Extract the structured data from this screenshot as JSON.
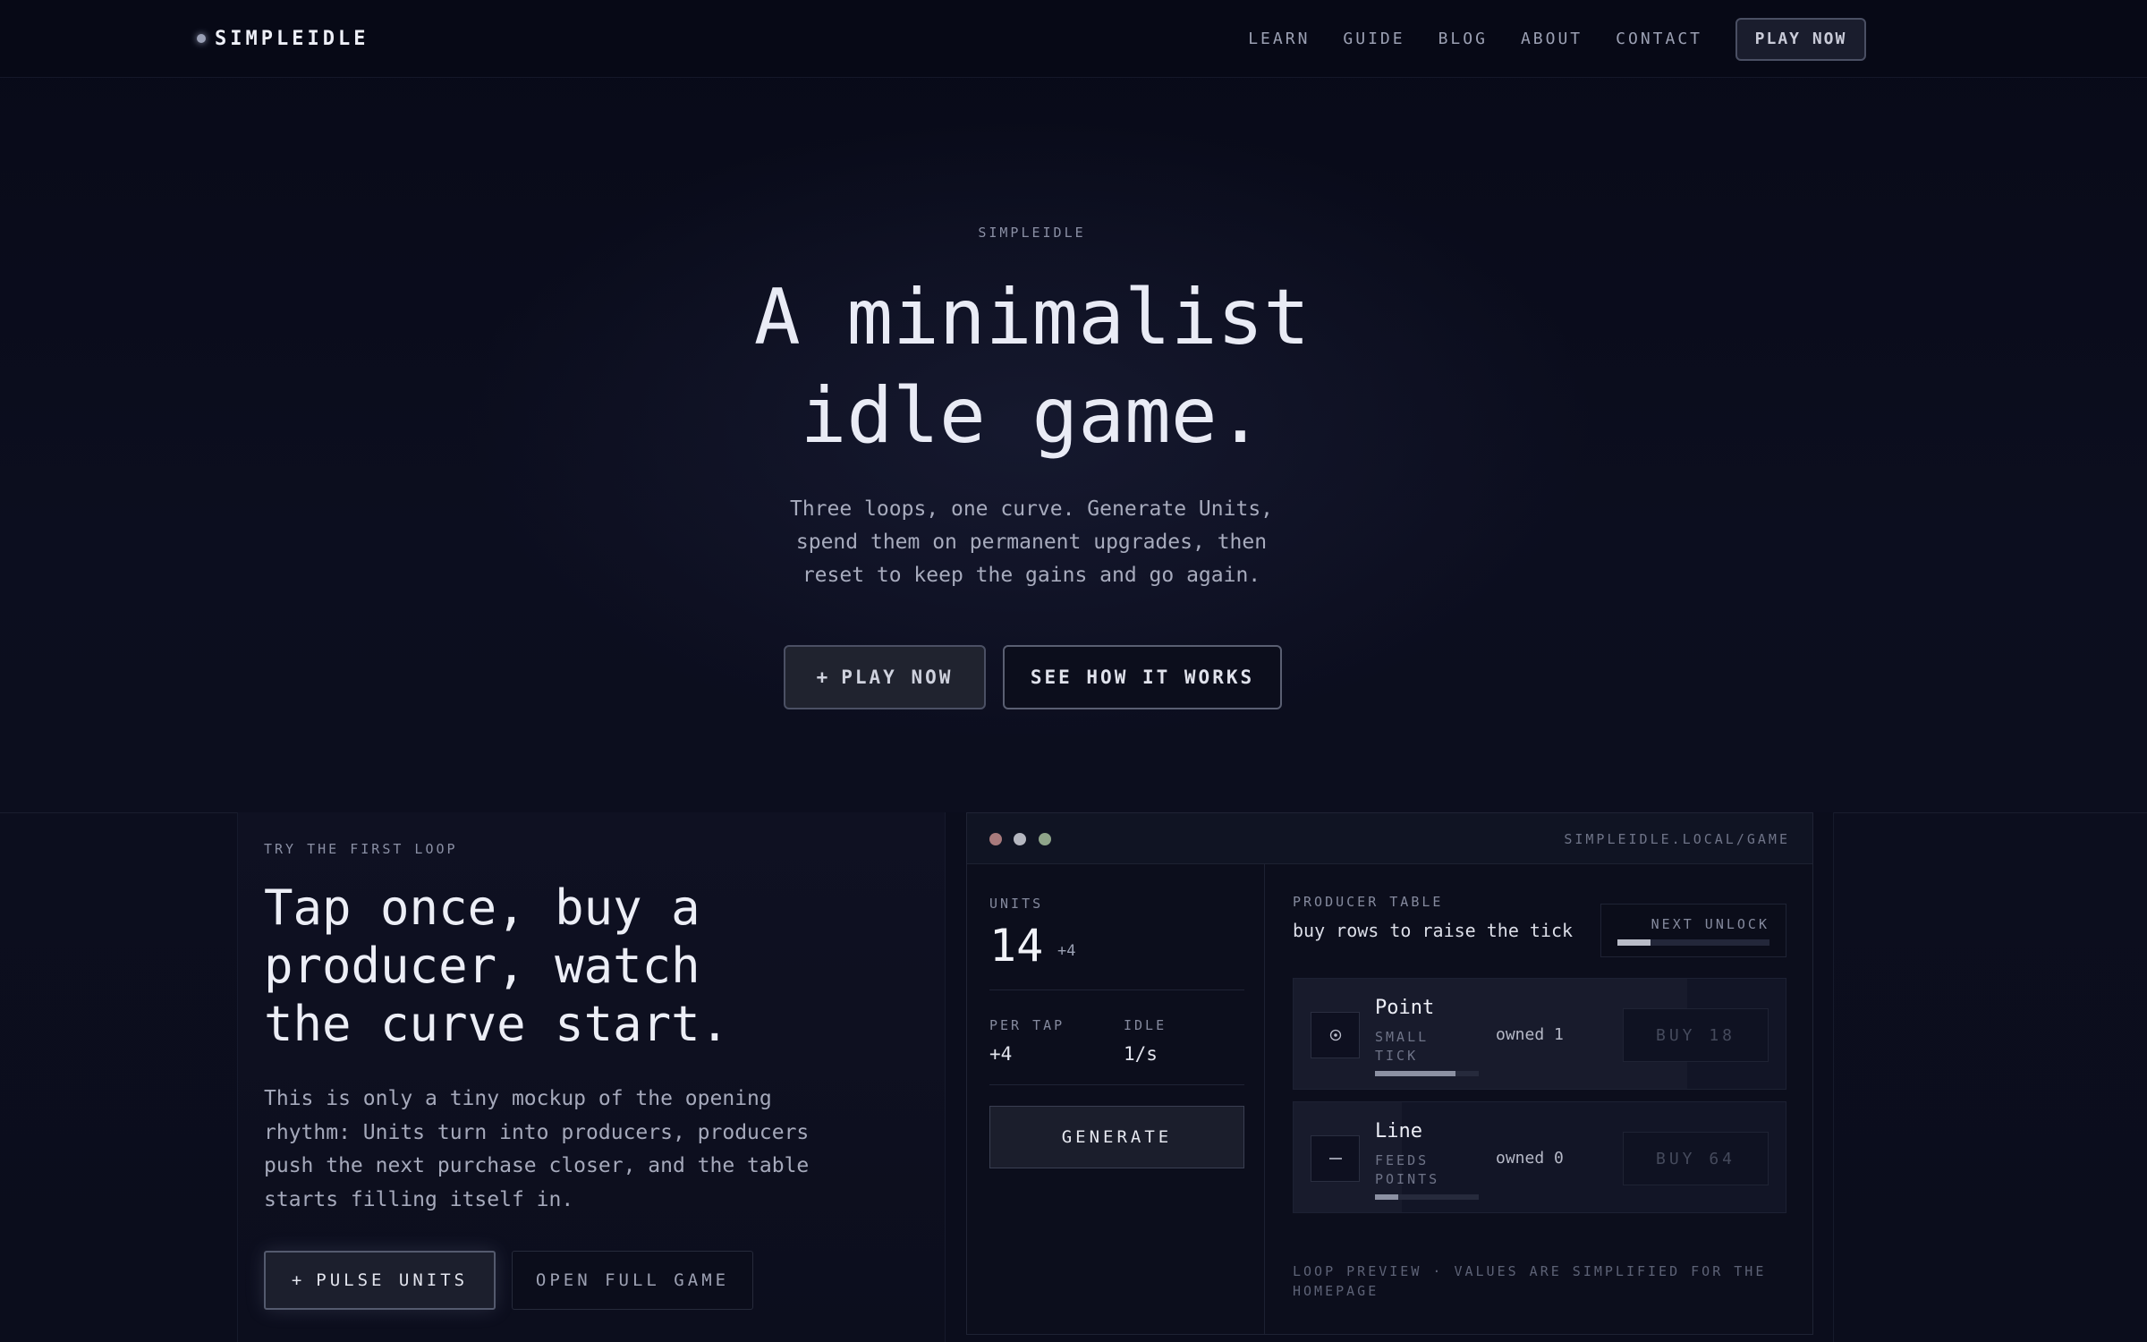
{
  "nav": {
    "brand": "SIMPLEIDLE",
    "links": [
      "LEARN",
      "GUIDE",
      "BLOG",
      "ABOUT",
      "CONTACT"
    ],
    "play_label": "PLAY NOW"
  },
  "hero": {
    "eyebrow": "SIMPLEIDLE",
    "title_line1": "A minimalist",
    "title_line2": "idle game.",
    "subtitle": "Three loops, one curve. Generate Units, spend them on permanent upgrades, then reset to keep the gains and go again.",
    "primary_button": "PLAY NOW",
    "secondary_button": "SEE HOW IT WORKS"
  },
  "loop": {
    "eyebrow": "TRY THE FIRST LOOP",
    "title_line1": "Tap once, buy a",
    "title_line2": "producer, watch",
    "title_line3": "the curve start.",
    "description": "This is only a tiny mockup of the opening rhythm: Units turn into producers, producers push the next purchase closer, and the table starts filling itself in.",
    "pulse_button": "PULSE UNITS",
    "full_game_button": "OPEN FULL GAME"
  },
  "game": {
    "url": "SIMPLEIDLE.LOCAL/GAME",
    "units_label": "UNITS",
    "units_value": "14",
    "units_delta": "+4",
    "per_tap_label": "PER TAP",
    "per_tap_value": "+4",
    "idle_label": "IDLE",
    "idle_value": "1/s",
    "generate_button": "GENERATE",
    "producer_table_label": "PRODUCER TABLE",
    "producer_table_sub": "buy rows to raise the tick",
    "next_unlock_label": "NEXT UNLOCK",
    "next_unlock_progress": 0.22,
    "producers": [
      {
        "name": "Point",
        "desc": "SMALL TICK",
        "owned": "owned 1",
        "buy": "BUY 18",
        "progress": 0.78,
        "highlight": 0.8,
        "icon": "target-icon"
      },
      {
        "name": "Line",
        "desc": "FEEDS POINTS",
        "owned": "owned 0",
        "buy": "BUY 64",
        "progress": 0.22,
        "highlight": 0.22,
        "icon": "dash-icon"
      }
    ],
    "footnote": "LOOP PREVIEW · VALUES ARE SIMPLIFIED FOR THE HOMEPAGE"
  },
  "colors": {
    "background": "#0b0d1c",
    "nav_background": "#070916",
    "text_primary": "#e9ebf5",
    "text_muted": "#8a8fa4"
  }
}
